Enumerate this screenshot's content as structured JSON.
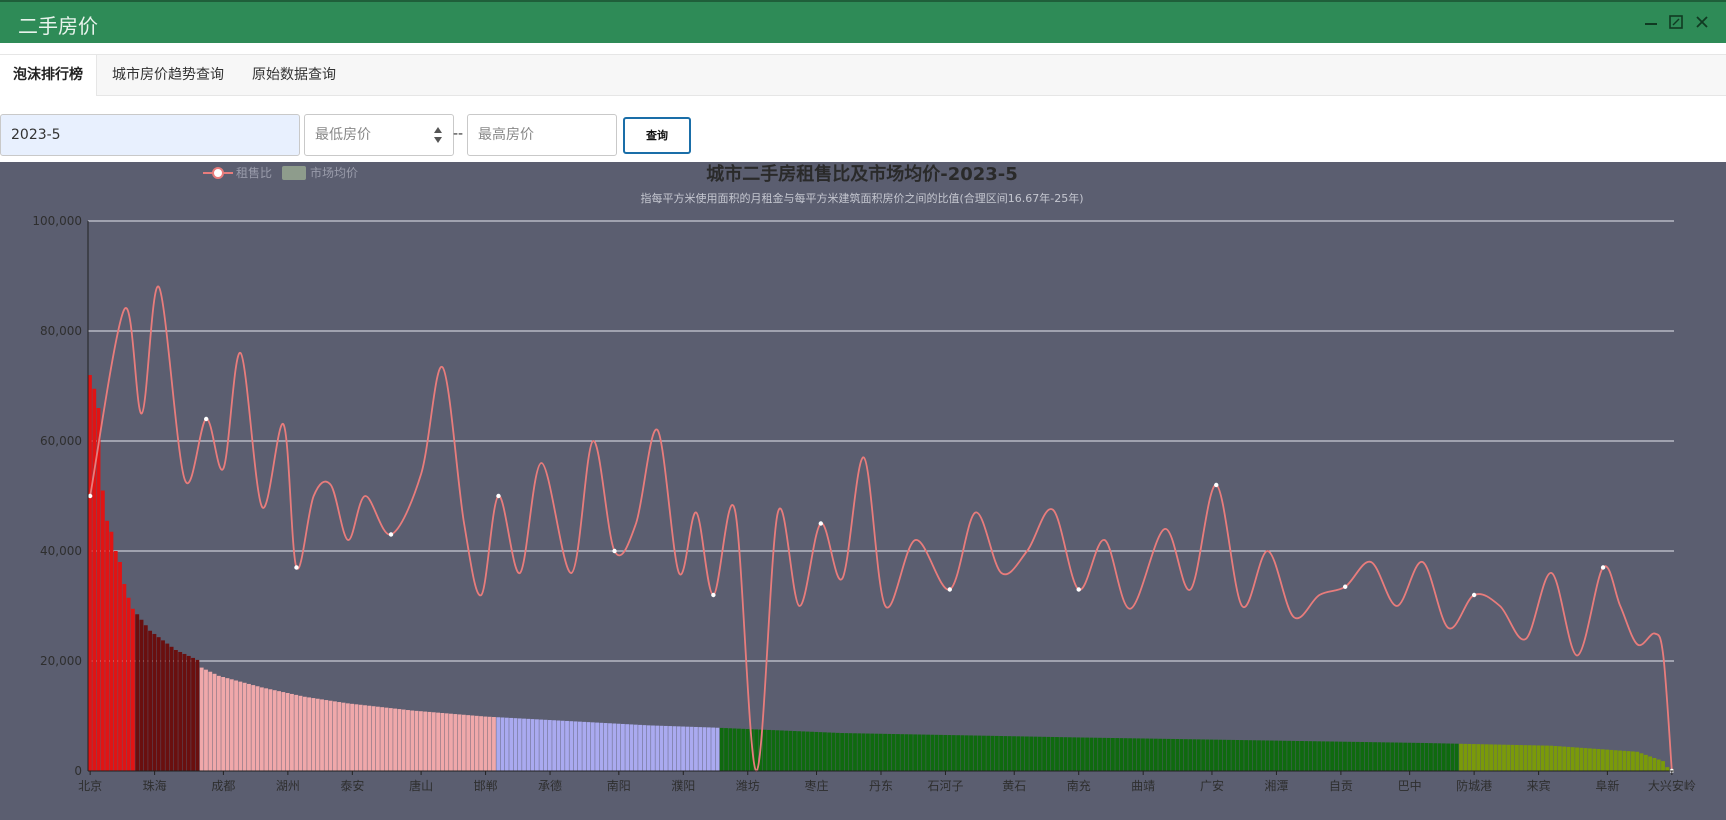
{
  "window": {
    "title": "二手房价"
  },
  "tabs": [
    {
      "label": "泡沫排行榜",
      "active": true
    },
    {
      "label": "城市房价趋势查询",
      "active": false
    },
    {
      "label": "原始数据查询",
      "active": false
    }
  ],
  "query": {
    "date_value": "2023-5",
    "min_price_placeholder": "最低房价",
    "max_price_placeholder": "最高房价",
    "separator": "--",
    "submit_label": "查询"
  },
  "icons": {
    "minimize": "minimize-icon",
    "maximize": "maximize-icon",
    "close": "close-icon"
  },
  "chart_data": {
    "type": "bar",
    "title": "城市二手房租售比及市场均价-2023-5",
    "subtitle": "指每平方米使用面积的月租金与每平方米建筑面积房价之间的比值(合理区间16.67年-25年)",
    "legend": [
      "租售比",
      "市场均价"
    ],
    "legend_position": "top-left",
    "grid": true,
    "ylim": [
      0,
      100000
    ],
    "yticks": [
      "0",
      "20,000",
      "40,000",
      "60,000",
      "80,000",
      "100,000"
    ],
    "xtick_labels": [
      "北京",
      "珠海",
      "成都",
      "湖州",
      "泰安",
      "唐山",
      "邯郸",
      "承德",
      "南阳",
      "濮阳",
      "潍坊",
      "枣庄",
      "丹东",
      "石河子",
      "黄石",
      "南充",
      "曲靖",
      "广安",
      "湘潭",
      "自贡",
      "巴中",
      "防城港",
      "来宾",
      "阜新",
      "大兴安岭"
    ],
    "price_levels": [
      {
        "index": 0,
        "value": 72000
      },
      {
        "index": 1,
        "value": 69500
      },
      {
        "index": 2,
        "value": 66000
      },
      {
        "index": 3,
        "value": 51000
      },
      {
        "index": 4,
        "value": 45500
      },
      {
        "index": 5,
        "value": 43500
      },
      {
        "index": 6,
        "value": 40000
      },
      {
        "index": 7,
        "value": 38000
      },
      {
        "index": 8,
        "value": 34000
      },
      {
        "index": 9,
        "value": 31500
      },
      {
        "index": 10,
        "value": 29500
      },
      {
        "index": 14,
        "value": 25500
      },
      {
        "index": 20,
        "value": 22000
      },
      {
        "index": 25,
        "value": 20200
      },
      {
        "index": 26,
        "value": 18800
      },
      {
        "index": 30,
        "value": 17300
      },
      {
        "index": 40,
        "value": 15200
      },
      {
        "index": 50,
        "value": 13500
      },
      {
        "index": 60,
        "value": 12300
      },
      {
        "index": 75,
        "value": 11000
      },
      {
        "index": 92,
        "value": 9900
      },
      {
        "index": 130,
        "value": 8300
      },
      {
        "index": 145,
        "value": 7900
      },
      {
        "index": 175,
        "value": 6900
      },
      {
        "index": 230,
        "value": 6100
      },
      {
        "index": 310,
        "value": 5100
      },
      {
        "index": 340,
        "value": 4600
      },
      {
        "index": 360,
        "value": 3500
      },
      {
        "index": 366,
        "value": 1800
      },
      {
        "index": 367,
        "value": 700
      },
      {
        "index": 368,
        "value": 300
      }
    ],
    "bar_colors": [
      {
        "from": 0,
        "to": 10,
        "color": "#e01414"
      },
      {
        "from": 11,
        "to": 25,
        "color": "#6a0f0f"
      },
      {
        "from": 26,
        "to": 94,
        "color": "#f0a8aa"
      },
      {
        "from": 95,
        "to": 146,
        "color": "#aaaaf0"
      },
      {
        "from": 147,
        "to": 318,
        "color": "#0f6a0f"
      },
      {
        "from": 319,
        "to": 368,
        "color": "#7a9a0a"
      }
    ],
    "ratio_series": {
      "name": "租售比",
      "color": "#e87c7c",
      "points_x": [
        0,
        8,
        12,
        16,
        22,
        27,
        31,
        35,
        40,
        45,
        48,
        52,
        56,
        60,
        64,
        70,
        77,
        82,
        87,
        91,
        95,
        100,
        105,
        112,
        117,
        122,
        127,
        132,
        137,
        141,
        145,
        150,
        155,
        160,
        165,
        170,
        175,
        180,
        185,
        192,
        200,
        206,
        212,
        218,
        224,
        230,
        236,
        242,
        250,
        256,
        262,
        268,
        274,
        280,
        286,
        292,
        298,
        304,
        310,
        316,
        322,
        328,
        334,
        340,
        346,
        352,
        356,
        360,
        364,
        366,
        368
      ],
      "points_y": [
        50000,
        84000,
        65000,
        88000,
        53000,
        64000,
        55000,
        76000,
        48000,
        63000,
        37000,
        50000,
        52000,
        42000,
        50000,
        43000,
        54000,
        73400,
        45000,
        32000,
        50000,
        36000,
        56000,
        36000,
        60000,
        40000,
        45000,
        62000,
        36000,
        47000,
        32000,
        47500,
        0,
        47000,
        30000,
        45000,
        35000,
        57000,
        30000,
        42000,
        33000,
        47000,
        36000,
        40000,
        47500,
        33000,
        42000,
        29500,
        44000,
        33000,
        52000,
        30000,
        40000,
        28000,
        32000,
        33500,
        38000,
        30000,
        38000,
        26000,
        32000,
        30000,
        24000,
        36000,
        21000,
        37000,
        30000,
        23000,
        25000,
        21000,
        0
      ]
    }
  }
}
